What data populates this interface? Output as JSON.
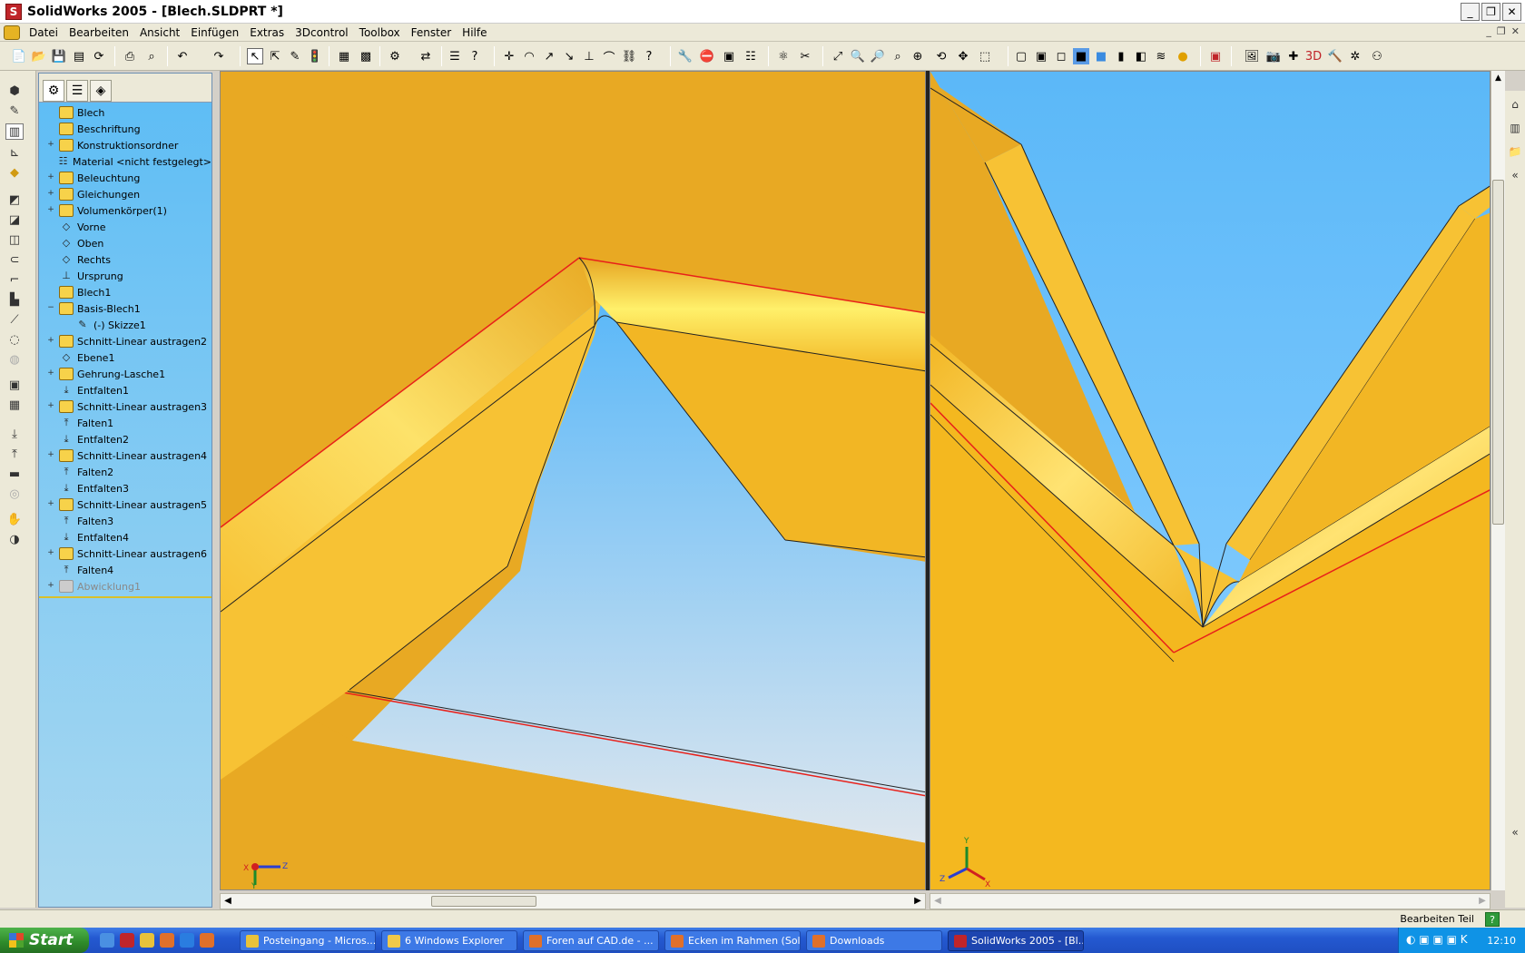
{
  "window": {
    "title": "SolidWorks 2005 - [Blech.SLDPRT *]",
    "app_icon": "solidworks-logo-icon",
    "controls": [
      "_",
      "❐",
      "✕"
    ],
    "mdi_controls": [
      "_",
      "❐",
      "✕"
    ]
  },
  "menu": {
    "items": [
      "Datei",
      "Bearbeiten",
      "Ansicht",
      "Einfügen",
      "Extras",
      "3Dcontrol",
      "Toolbox",
      "Fenster",
      "Hilfe"
    ]
  },
  "feature_manager": {
    "tabs": [
      "featuremanager-tab-icon",
      "propertymanager-tab-icon",
      "configurationmanager-tab-icon"
    ],
    "items": [
      {
        "label": "Blech",
        "icon": "part-icon",
        "expand": ""
      },
      {
        "label": "Beschriftung",
        "icon": "annotation-icon",
        "expand": ""
      },
      {
        "label": "Konstruktionsordner",
        "icon": "folder-icon",
        "expand": "+"
      },
      {
        "label": "Material <nicht festgelegt>",
        "icon": "material-icon",
        "expand": ""
      },
      {
        "label": "Beleuchtung",
        "icon": "lighting-icon",
        "expand": "+"
      },
      {
        "label": "Gleichungen",
        "icon": "equations-icon",
        "expand": "+"
      },
      {
        "label": "Volumenkörper(1)",
        "icon": "solid-bodies-icon",
        "expand": "+"
      },
      {
        "label": "Vorne",
        "icon": "plane-icon",
        "expand": ""
      },
      {
        "label": "Oben",
        "icon": "plane-icon",
        "expand": ""
      },
      {
        "label": "Rechts",
        "icon": "plane-icon",
        "expand": ""
      },
      {
        "label": "Ursprung",
        "icon": "origin-icon",
        "expand": ""
      },
      {
        "label": "Blech1",
        "icon": "sheetmetal-icon",
        "expand": ""
      },
      {
        "label": "Basis-Blech1",
        "icon": "base-flange-icon",
        "expand": "−"
      },
      {
        "label": "(-) Skizze1",
        "icon": "sketch-icon",
        "expand": "",
        "indent": true
      },
      {
        "label": "Schnitt-Linear austragen2",
        "icon": "cut-extrude-icon",
        "expand": "+"
      },
      {
        "label": "Ebene1",
        "icon": "plane-icon",
        "expand": ""
      },
      {
        "label": "Gehrung-Lasche1",
        "icon": "miter-flange-icon",
        "expand": "+"
      },
      {
        "label": "Entfalten1",
        "icon": "unfold-icon",
        "expand": ""
      },
      {
        "label": "Schnitt-Linear austragen3",
        "icon": "cut-extrude-icon",
        "expand": "+"
      },
      {
        "label": "Falten1",
        "icon": "fold-icon",
        "expand": ""
      },
      {
        "label": "Entfalten2",
        "icon": "unfold-icon",
        "expand": ""
      },
      {
        "label": "Schnitt-Linear austragen4",
        "icon": "cut-extrude-icon",
        "expand": "+"
      },
      {
        "label": "Falten2",
        "icon": "fold-icon",
        "expand": ""
      },
      {
        "label": "Entfalten3",
        "icon": "unfold-icon",
        "expand": ""
      },
      {
        "label": "Schnitt-Linear austragen5",
        "icon": "cut-extrude-icon",
        "expand": "+"
      },
      {
        "label": "Falten3",
        "icon": "fold-icon",
        "expand": ""
      },
      {
        "label": "Entfalten4",
        "icon": "unfold-icon",
        "expand": ""
      },
      {
        "label": "Schnitt-Linear austragen6",
        "icon": "cut-extrude-icon",
        "expand": "+"
      },
      {
        "label": "Falten4",
        "icon": "fold-icon",
        "expand": ""
      },
      {
        "label": "Abwicklung1",
        "icon": "flat-pattern-icon",
        "expand": "+",
        "suppressed": true
      }
    ]
  },
  "viewport": {
    "left_axes": {
      "x": "X",
      "y": "Y",
      "z": "Z"
    },
    "right_axes": {
      "x": "X",
      "y": "Y",
      "z": "Z"
    }
  },
  "status": {
    "text": "Bearbeiten Teil",
    "help_icon": "?"
  },
  "taskbar": {
    "start_label": "Start",
    "tasks": [
      {
        "label": "Posteingang - Micros...",
        "icon": "outlook-icon",
        "color": "#e8c23a"
      },
      {
        "label": "6 Windows Explorer",
        "icon": "folder-icon",
        "color": "#f0c94a"
      },
      {
        "label": "Foren auf CAD.de - ...",
        "icon": "firefox-icon",
        "color": "#e0702a"
      },
      {
        "label": "Ecken im Rahmen (Sol...",
        "icon": "firefox-icon",
        "color": "#e0702a"
      },
      {
        "label": "Downloads",
        "icon": "firefox-icon",
        "color": "#e0702a"
      },
      {
        "label": "SolidWorks 2005 - [Bl...",
        "icon": "solidworks-icon",
        "color": "#c0252a",
        "active": true
      }
    ],
    "clock": "12:10"
  },
  "colors": {
    "sheet_metal": "#f2b624",
    "sky_top": "#5bb8f8",
    "sky_bottom": "#d8e4ee",
    "edge_red": "#e8201a"
  }
}
